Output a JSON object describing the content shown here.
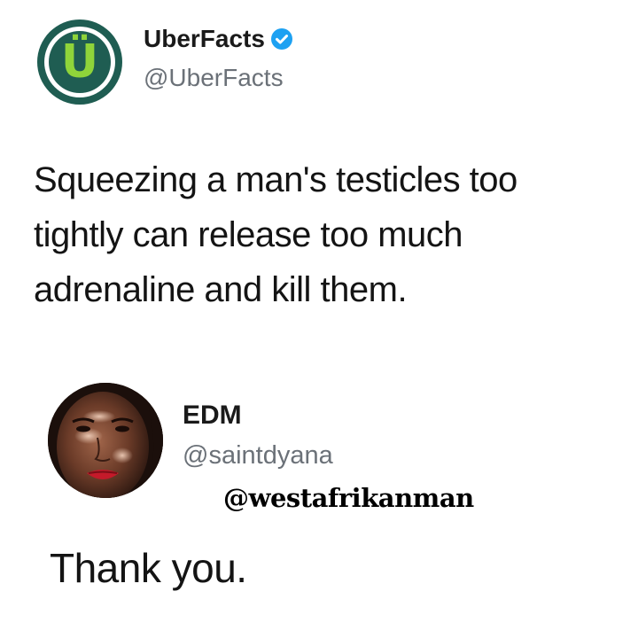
{
  "tweet": {
    "author_name": "UberFacts",
    "author_handle": "@UberFacts",
    "verified": true,
    "avatar_glyph": "Ü",
    "text": "Squeezing a man's testicles too tightly can release too much adrenaline and kill them."
  },
  "reply": {
    "author_name": "EDM",
    "author_handle": "@saintdyana",
    "text": "Thank you."
  },
  "watermark": "@westafrikanman",
  "colors": {
    "uberfacts_dark_green": "#1f5d52",
    "uberfacts_lime": "#8fd43a",
    "verified_blue": "#1da1f2",
    "handle_gray": "#6b7178",
    "text": "#141414"
  },
  "icons": {
    "verified": "verified-badge-icon"
  }
}
